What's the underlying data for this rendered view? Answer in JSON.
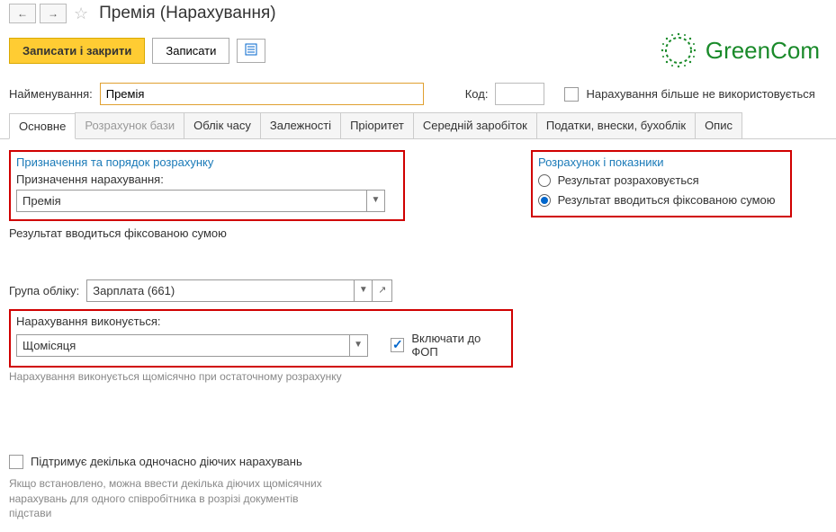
{
  "header": {
    "title": "Премія (Нарахування)",
    "save_close": "Записати і закрити",
    "save": "Записати"
  },
  "logo": {
    "text": "GreenCom"
  },
  "fields": {
    "name_label": "Найменування:",
    "name_value": "Премія",
    "code_label": "Код:",
    "code_value": "",
    "not_used_label": "Нарахування більше не використовується"
  },
  "tabs": [
    "Основне",
    "Розрахунок бази",
    "Облік часу",
    "Залежності",
    "Пріоритет",
    "Середній заробіток",
    "Податки, внески, бухоблік",
    "Опис"
  ],
  "section1": {
    "title": "Призначення та порядок розрахунку",
    "label": "Призначення нарахування:",
    "value": "Премія",
    "result_text": "Результат вводиться фіксованою сумою"
  },
  "group": {
    "label": "Група обліку:",
    "value": "Зарплата (661)"
  },
  "section2": {
    "label": "Нарахування виконується:",
    "value": "Щомісяця",
    "include_fop": "Включати до ФОП",
    "hint": "Нарахування виконується щомісячно при остаточному розрахунку"
  },
  "support": {
    "label": "Підтримує декілька одночасно діючих нарахувань",
    "hint": "Якщо встановлено, можна ввести декілька діючих щомісячних нарахувань для одного співробітника в розрізі документів підстави"
  },
  "calc": {
    "title": "Розрахунок і показники",
    "opt1": "Результат розраховується",
    "opt2": "Результат вводиться фіксованою сумою"
  }
}
